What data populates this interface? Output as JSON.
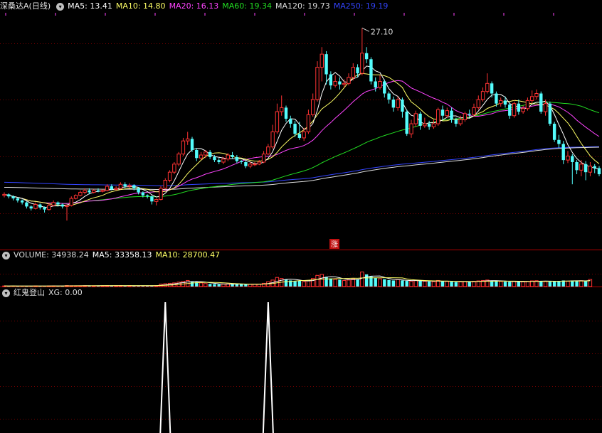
{
  "header": {
    "stock_name": "深桑达A",
    "period": "(日线)",
    "ma": [
      {
        "label": "MA5: 13.41",
        "color": "#ffffff"
      },
      {
        "label": "MA10: 14.80",
        "color": "#ffff66"
      },
      {
        "label": "MA20: 16.13",
        "color": "#ff44ff"
      },
      {
        "label": "MA60: 19.34",
        "color": "#22dd22"
      },
      {
        "label": "MA120: 19.73",
        "color": "#dddddd"
      },
      {
        "label": "MA250: 19.19",
        "color": "#3344ff"
      }
    ]
  },
  "volume_header": {
    "title": "VOLUME: 34938.24",
    "ma5": "MA5: 33358.13",
    "ma10": "MA10: 28700.47"
  },
  "indicator_header": {
    "title": "红鬼登山",
    "xg": "XG: 0.00"
  },
  "chart_data": {
    "type": "candlestick",
    "price_range": [
      5.2,
      28.6
    ],
    "peak_annotation": "27.10",
    "zhang_marker": "涨",
    "colors": {
      "up": "#ff3333",
      "down": "#54fcfc",
      "ma5": "#ffffff",
      "ma10": "#ffff66",
      "ma20": "#ff44ff",
      "ma60": "#22dd22",
      "ma120": "#dddddd",
      "ma250": "#3344ff"
    },
    "candles": [
      [
        10.5,
        10.6,
        10.8,
        10.3
      ],
      [
        10.6,
        10.4,
        10.7,
        10.2
      ],
      [
        10.4,
        10.2,
        10.5,
        10.0
      ],
      [
        10.2,
        10.0,
        10.3,
        9.8
      ],
      [
        10.0,
        9.8,
        10.1,
        9.6
      ],
      [
        9.8,
        9.4,
        9.9,
        9.2
      ],
      [
        9.4,
        9.2,
        9.5,
        9.0
      ],
      [
        9.2,
        9.6,
        9.8,
        9.1
      ],
      [
        9.6,
        9.3,
        9.7,
        9.1
      ],
      [
        9.3,
        9.1,
        9.4,
        8.8
      ],
      [
        9.1,
        9.5,
        9.7,
        9.0
      ],
      [
        9.5,
        9.8,
        10.0,
        9.4
      ],
      [
        9.8,
        9.6,
        9.9,
        9.4
      ],
      [
        9.6,
        9.4,
        9.7,
        9.2
      ],
      [
        9.4,
        9.5,
        9.6,
        8.0
      ],
      [
        9.5,
        10.2,
        10.4,
        9.4
      ],
      [
        10.2,
        10.5,
        10.6,
        10.1
      ],
      [
        10.5,
        10.8,
        11.0,
        10.4
      ],
      [
        10.8,
        11.0,
        11.2,
        10.6
      ],
      [
        11.0,
        10.8,
        11.2,
        10.6
      ],
      [
        10.8,
        11.0,
        11.1,
        10.7
      ],
      [
        11.0,
        10.9,
        11.2,
        10.8
      ],
      [
        10.9,
        11.0,
        11.1,
        10.8
      ],
      [
        11.0,
        11.4,
        11.6,
        10.9
      ],
      [
        11.4,
        11.1,
        11.6,
        11.0
      ],
      [
        11.1,
        11.2,
        11.4,
        11.0
      ],
      [
        11.2,
        11.6,
        11.8,
        11.1
      ],
      [
        11.6,
        11.4,
        11.8,
        11.2
      ],
      [
        11.4,
        11.5,
        11.7,
        11.2
      ],
      [
        11.5,
        11.2,
        11.6,
        11.0
      ],
      [
        11.2,
        10.8,
        11.3,
        10.6
      ],
      [
        10.8,
        10.5,
        10.9,
        10.3
      ],
      [
        10.5,
        10.4,
        10.6,
        10.2
      ],
      [
        10.4,
        9.9,
        10.5,
        9.6
      ],
      [
        9.9,
        10.1,
        10.2,
        9.5
      ],
      [
        10.1,
        11.2,
        11.4,
        10.0
      ],
      [
        11.2,
        12.0,
        12.2,
        11.1
      ],
      [
        12.0,
        12.8,
        13.0,
        11.8
      ],
      [
        12.8,
        13.6,
        13.8,
        12.6
      ],
      [
        13.6,
        14.6,
        14.8,
        13.4
      ],
      [
        14.6,
        15.9,
        16.2,
        14.4
      ],
      [
        15.9,
        16.1,
        16.8,
        15.5
      ],
      [
        16.1,
        15.0,
        16.3,
        14.8
      ],
      [
        15.0,
        14.2,
        15.2,
        13.9
      ],
      [
        14.2,
        14.5,
        14.8,
        14.0
      ],
      [
        14.5,
        14.8,
        15.0,
        14.2
      ],
      [
        14.8,
        14.3,
        15.0,
        14.1
      ],
      [
        14.3,
        14.0,
        14.5,
        13.8
      ],
      [
        14.0,
        13.8,
        14.2,
        13.6
      ],
      [
        13.8,
        14.1,
        14.3,
        13.6
      ],
      [
        14.1,
        14.5,
        14.7,
        13.9
      ],
      [
        14.5,
        14.3,
        14.8,
        14.1
      ],
      [
        14.3,
        13.9,
        14.5,
        13.7
      ],
      [
        13.9,
        13.8,
        14.0,
        13.6
      ],
      [
        13.8,
        13.4,
        13.9,
        13.2
      ],
      [
        13.4,
        13.6,
        13.8,
        13.2
      ],
      [
        13.6,
        13.6,
        13.8,
        13.4
      ],
      [
        13.6,
        13.8,
        14.0,
        13.5
      ],
      [
        13.8,
        14.6,
        14.9,
        13.7
      ],
      [
        14.6,
        15.3,
        15.6,
        14.5
      ],
      [
        15.3,
        16.8,
        17.5,
        15.1
      ],
      [
        16.8,
        18.8,
        19.6,
        16.6
      ],
      [
        18.8,
        19.2,
        20.4,
        18.4
      ],
      [
        19.2,
        18.1,
        19.4,
        17.8
      ],
      [
        18.1,
        17.6,
        18.4,
        17.2
      ],
      [
        17.6,
        16.6,
        17.9,
        16.3
      ],
      [
        16.6,
        16.2,
        17.8,
        16.0
      ],
      [
        16.2,
        16.8,
        17.2,
        15.9
      ],
      [
        16.8,
        18.5,
        19.0,
        16.6
      ],
      [
        18.5,
        20.0,
        20.6,
        18.3
      ],
      [
        20.0,
        23.2,
        23.8,
        19.8
      ],
      [
        23.2,
        24.5,
        25.2,
        21.8
      ],
      [
        24.5,
        22.5,
        24.8,
        21.5
      ],
      [
        22.5,
        21.4,
        22.8,
        21.0
      ],
      [
        21.4,
        21.8,
        22.4,
        21.2
      ],
      [
        21.8,
        21.5,
        22.2,
        21.0
      ],
      [
        21.5,
        21.6,
        22.0,
        21.2
      ],
      [
        21.6,
        22.2,
        22.6,
        21.4
      ],
      [
        22.2,
        23.2,
        23.6,
        21.9
      ],
      [
        23.2,
        22.6,
        23.5,
        22.2
      ],
      [
        22.6,
        24.6,
        27.1,
        22.4
      ],
      [
        24.6,
        24.0,
        25.2,
        23.6
      ],
      [
        24.0,
        21.8,
        24.2,
        21.5
      ],
      [
        21.8,
        21.2,
        22.2,
        20.8
      ],
      [
        21.2,
        21.8,
        22.4,
        21.0
      ],
      [
        21.8,
        20.6,
        22.0,
        20.2
      ],
      [
        20.6,
        20.0,
        20.8,
        19.6
      ],
      [
        20.0,
        19.2,
        20.3,
        18.8
      ],
      [
        19.2,
        20.0,
        20.3,
        18.9
      ],
      [
        20.0,
        18.8,
        20.2,
        18.2
      ],
      [
        18.8,
        16.6,
        19.0,
        16.4
      ],
      [
        16.6,
        17.6,
        18.0,
        16.2
      ],
      [
        17.6,
        18.6,
        18.9,
        17.3
      ],
      [
        18.6,
        17.4,
        18.8,
        17.0
      ],
      [
        17.4,
        17.6,
        18.2,
        17.2
      ],
      [
        17.6,
        17.3,
        17.9,
        17.0
      ],
      [
        17.3,
        17.6,
        18.0,
        17.1
      ],
      [
        17.6,
        19.0,
        19.2,
        17.4
      ],
      [
        19.0,
        18.4,
        19.4,
        18.0
      ],
      [
        18.4,
        18.9,
        19.2,
        18.2
      ],
      [
        18.9,
        18.0,
        19.2,
        17.7
      ],
      [
        18.0,
        17.6,
        18.2,
        17.3
      ],
      [
        17.6,
        18.0,
        18.4,
        17.4
      ],
      [
        18.0,
        18.6,
        18.8,
        17.8
      ],
      [
        18.6,
        18.5,
        19.0,
        18.2
      ],
      [
        18.5,
        19.2,
        19.6,
        18.3
      ],
      [
        19.2,
        20.0,
        20.4,
        19.0
      ],
      [
        20.0,
        20.8,
        21.2,
        19.8
      ],
      [
        20.8,
        21.6,
        22.6,
        20.6
      ],
      [
        21.6,
        20.6,
        21.8,
        20.2
      ],
      [
        20.6,
        19.6,
        20.8,
        19.3
      ],
      [
        19.6,
        19.9,
        20.2,
        19.3
      ],
      [
        19.9,
        19.5,
        20.3,
        19.2
      ],
      [
        19.5,
        18.4,
        19.7,
        18.1
      ],
      [
        18.4,
        19.6,
        19.8,
        18.2
      ],
      [
        19.6,
        18.8,
        20.0,
        18.5
      ],
      [
        18.8,
        19.1,
        19.4,
        18.6
      ],
      [
        19.1,
        19.9,
        20.2,
        18.9
      ],
      [
        19.9,
        20.3,
        20.9,
        19.6
      ],
      [
        20.3,
        20.6,
        21.0,
        20.0
      ],
      [
        20.6,
        18.8,
        20.8,
        18.6
      ],
      [
        18.8,
        19.6,
        20.0,
        18.4
      ],
      [
        19.6,
        17.6,
        19.8,
        17.4
      ],
      [
        17.6,
        16.0,
        17.8,
        15.8
      ],
      [
        16.0,
        15.6,
        16.5,
        15.2
      ],
      [
        15.6,
        14.0,
        15.9,
        13.6
      ],
      [
        14.0,
        14.4,
        14.9,
        13.7
      ],
      [
        14.4,
        13.8,
        14.6,
        11.6
      ],
      [
        13.8,
        13.0,
        14.0,
        12.6
      ],
      [
        13.0,
        13.6,
        14.0,
        12.4
      ],
      [
        13.6,
        12.8,
        13.9,
        12.0
      ],
      [
        12.8,
        13.4,
        13.8,
        12.4
      ],
      [
        13.4,
        13.2,
        13.6,
        12.7
      ],
      [
        13.2,
        12.6,
        13.4,
        12.4
      ]
    ],
    "volume_range": [
      0,
      130000
    ],
    "volumes": [
      3000,
      2800,
      3200,
      2600,
      3100,
      2500,
      2700,
      3000,
      2600,
      2900,
      3200,
      3400,
      3000,
      2800,
      5000,
      4200,
      3800,
      4000,
      4400,
      4100,
      3900,
      4300,
      4000,
      4600,
      4200,
      4400,
      4800,
      4500,
      4700,
      4300,
      4000,
      3800,
      3600,
      5200,
      4800,
      12000,
      14000,
      16000,
      18000,
      22000,
      26000,
      30000,
      26000,
      22000,
      18000,
      15000,
      13000,
      12000,
      11000,
      12000,
      13000,
      12500,
      11500,
      11000,
      10500,
      11000,
      11500,
      12000,
      16000,
      24000,
      32000,
      45000,
      40000,
      35000,
      30000,
      26000,
      28000,
      24000,
      30000,
      40000,
      55000,
      60000,
      48000,
      40000,
      36000,
      34000,
      30000,
      32000,
      38000,
      36000,
      72000,
      60000,
      50000,
      42000,
      38000,
      36000,
      32000,
      30000,
      34000,
      30000,
      28000,
      26000,
      30000,
      28000,
      26000,
      25000,
      24000,
      30000,
      27000,
      25000,
      24000,
      22000,
      23000,
      25000,
      24000,
      26000,
      28000,
      30000,
      32000,
      28000,
      26000,
      25000,
      24000,
      23000,
      25000,
      24000,
      23000,
      26000,
      28000,
      29000,
      27000,
      25000,
      24000,
      26000,
      28000,
      30000,
      26000,
      30000,
      28000,
      29000,
      27000,
      35000
    ],
    "vol_ma5_label": "MA5: 33358.13",
    "signals": [
      {
        "index": 36,
        "value": 1
      },
      {
        "index": 59,
        "value": 1
      }
    ]
  }
}
